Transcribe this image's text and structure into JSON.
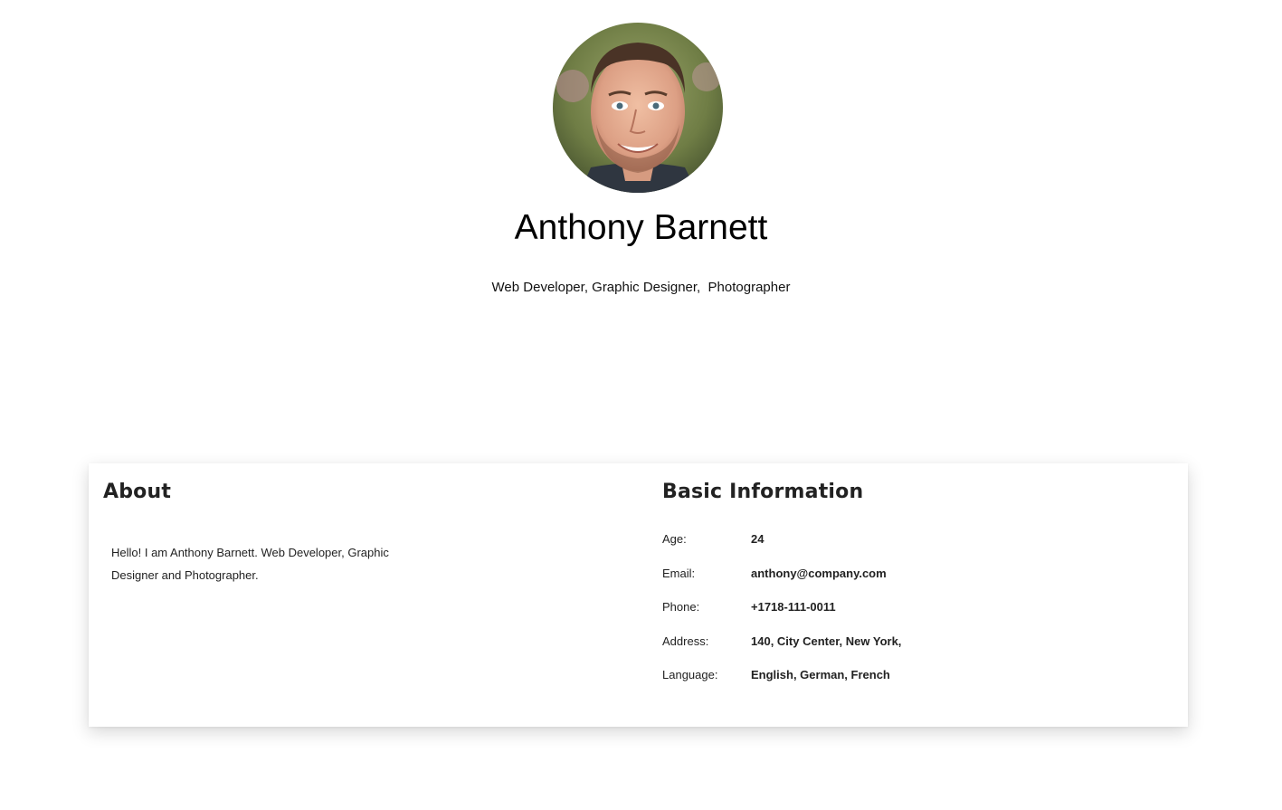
{
  "profile": {
    "name": "Anthony Barnett",
    "tagline": "Web Developer, Graphic Designer,  Photographer",
    "avatar_icon": "profile-photo"
  },
  "about": {
    "title": "About",
    "text": "Hello! I am Anthony Barnett. Web Developer, Graphic Designer and Photographer."
  },
  "basic_info": {
    "title": "Basic Information",
    "rows": [
      {
        "label": "Age:",
        "value": "24"
      },
      {
        "label": "Email:",
        "value": "anthony@company.com"
      },
      {
        "label": "Phone:",
        "value": "+1718-111-0011"
      },
      {
        "label": "Address:",
        "value": "140, City Center, New York,"
      },
      {
        "label": "Language:",
        "value": "English, German, French"
      }
    ]
  }
}
